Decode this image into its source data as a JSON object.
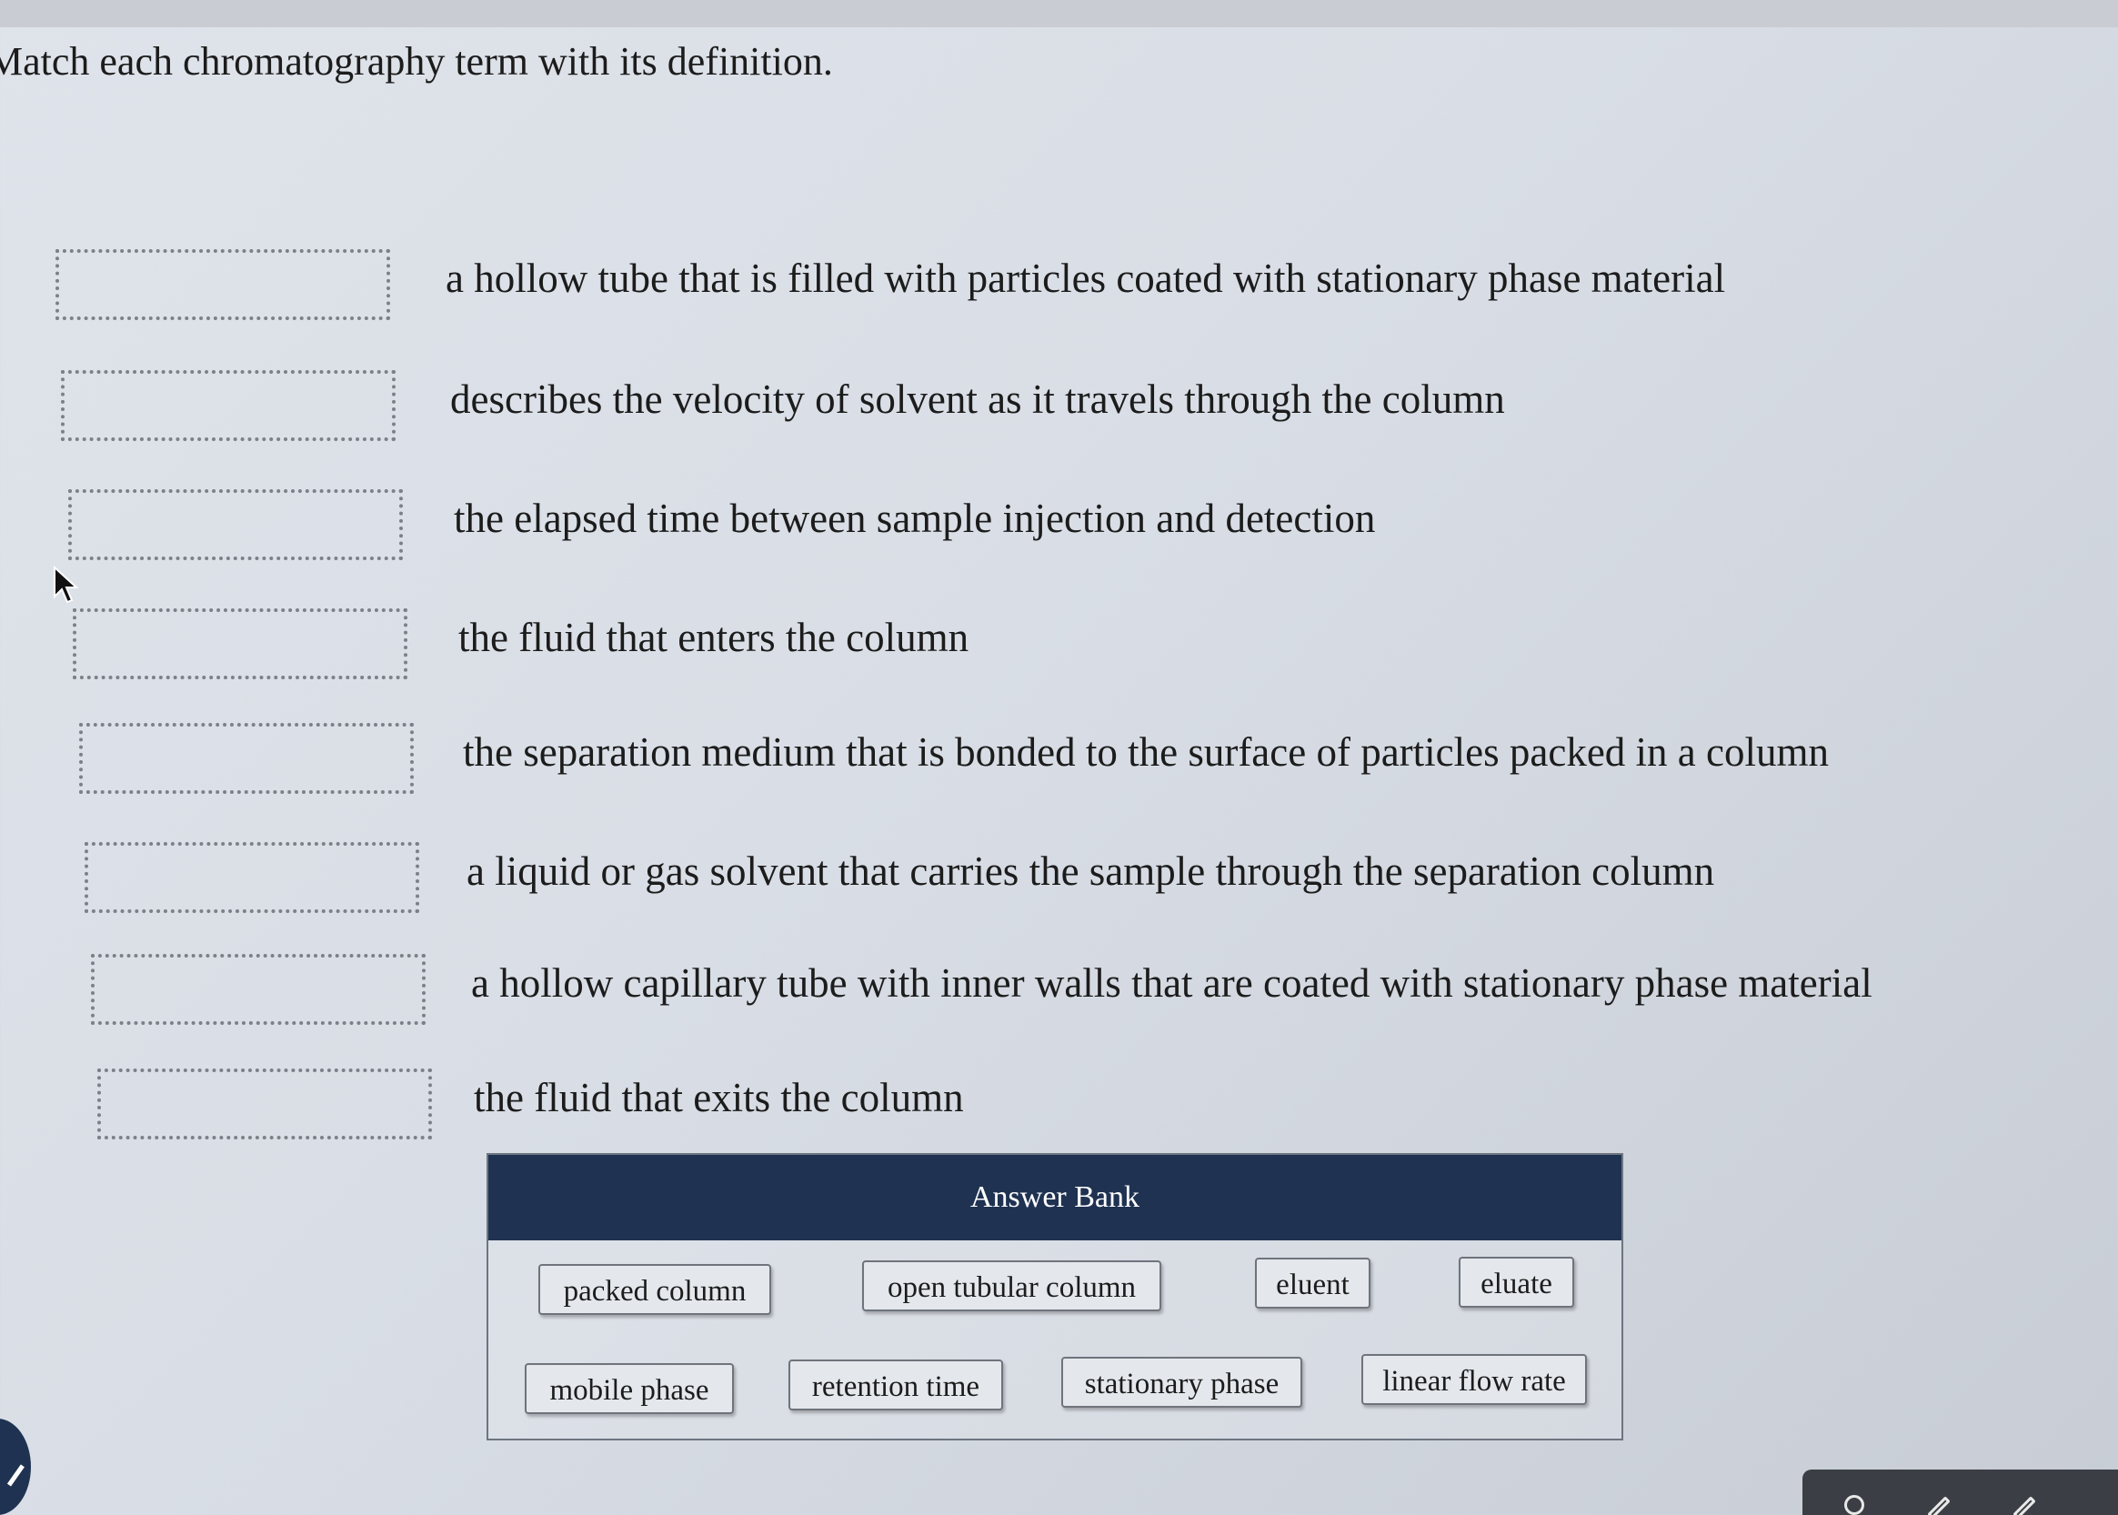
{
  "prompt": "Match each chromatography term with its definition.",
  "definitions": [
    "a hollow tube that is filled with particles coated with stationary phase material",
    "describes the velocity of solvent as it travels through the column",
    "the elapsed time between sample injection and detection",
    "the fluid that enters the column",
    "the separation medium that is bonded to the surface of particles packed in a column",
    "a liquid or gas solvent that carries the sample through the separation column",
    "a hollow capillary tube with inner walls that are coated with stationary phase material",
    "the fluid that exits the column"
  ],
  "answer_bank": {
    "title": "Answer Bank",
    "terms": [
      "packed column",
      "open tubular column",
      "eluent",
      "eluate",
      "mobile phase",
      "retention time",
      "stationary phase",
      "linear flow rate"
    ]
  },
  "colors": {
    "bank_header": "#1f3252",
    "page_background": "#dfe3ea"
  }
}
